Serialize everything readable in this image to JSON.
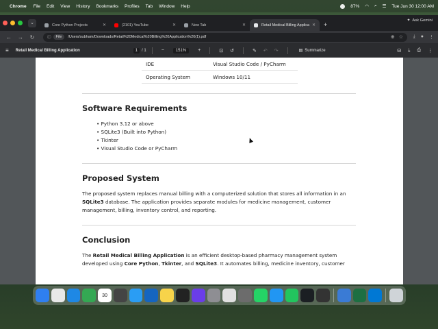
{
  "menubar": {
    "app_name": "Chrome",
    "items": [
      "File",
      "Edit",
      "View",
      "History",
      "Bookmarks",
      "Profiles",
      "Tab",
      "Window",
      "Help"
    ],
    "battery": "87%",
    "datetime": "Tue Jun 30  12:00 AM"
  },
  "tabs": [
    {
      "title": "Core Python Projects",
      "color": "#9aa0a6"
    },
    {
      "title": "(2101) YouTube",
      "color": "#ff0000"
    },
    {
      "title": "New Tab",
      "color": "#9aa0a6"
    },
    {
      "title": "Retail Medical Billing Applica",
      "color": "#e8eaed"
    }
  ],
  "ask_label": "Ask Gemini",
  "omnibox": {
    "chip": "File",
    "url": "/Users/subham/Downloads/Retail%20Medical%20Billing%20Application%20(1).pdf"
  },
  "pdf_toolbar": {
    "title": "Retail Medical Billing Application",
    "page_current": "1",
    "page_total": "/  1",
    "zoom": "151%",
    "summarize": "Summarize"
  },
  "document": {
    "spec_rows": [
      {
        "key": "IDE",
        "value": "Visual Studio Code / PyCharm"
      },
      {
        "key": "Operating System",
        "value": "Windows 10/11"
      }
    ],
    "software_heading": "Software Requirements",
    "software_items": [
      "Python 3.12 or above",
      "SQLite3 (Built into Python)",
      "Tkinter",
      "Visual Studio Code or PyCharm"
    ],
    "proposed_heading": "Proposed System",
    "proposed_pre": "The proposed system replaces manual billing with a computerized solution that stores all information in an ",
    "proposed_bold": "SQLite3",
    "proposed_post": " database. The application provides separate modules for medicine management, customer management, billing, inventory control, and reporting.",
    "conclusion_heading": "Conclusion",
    "conclusion_pre": "The ",
    "conclusion_bold1": "Retail Medical Billing Application",
    "conclusion_mid1": " is an efficient desktop-based pharmacy management system developed using ",
    "conclusion_bold2": "Core Python",
    "conclusion_comma": ", ",
    "conclusion_bold3": "Tkinter",
    "conclusion_and": ", and ",
    "conclusion_bold4": "SQLite3",
    "conclusion_post": ". It automates billing, medicine inventory, customer"
  },
  "dock": {
    "apps": [
      {
        "name": "finder",
        "color": "#2f7ff0"
      },
      {
        "name": "launchpad",
        "color": "#e8e8e8"
      },
      {
        "name": "safari",
        "color": "#1e88e5"
      },
      {
        "name": "chrome",
        "color": "#34a853"
      },
      {
        "name": "calendar",
        "color": "#ffffff",
        "label": "30"
      },
      {
        "name": "camera",
        "color": "#444444"
      },
      {
        "name": "quicktime",
        "color": "#2a9df4"
      },
      {
        "name": "finder-alt",
        "color": "#1565c0"
      },
      {
        "name": "notes",
        "color": "#f7d34a"
      },
      {
        "name": "terminal",
        "color": "#222222"
      },
      {
        "name": "imovie",
        "color": "#6a3de8"
      },
      {
        "name": "settings",
        "color": "#8e8e93"
      },
      {
        "name": "script-editor",
        "color": "#e0e0e0"
      },
      {
        "name": "sqlite",
        "color": "#6c6c6c"
      },
      {
        "name": "whatsapp",
        "color": "#25d366"
      },
      {
        "name": "vscode",
        "color": "#2196f3"
      },
      {
        "name": "pycharm",
        "color": "#22c55e"
      },
      {
        "name": "github",
        "color": "#1b1f23"
      },
      {
        "name": "cube",
        "color": "#333333"
      },
      {
        "name": "preview",
        "color": "#3a7bd5"
      },
      {
        "name": "excel",
        "color": "#1d6f42"
      },
      {
        "name": "vscode-alt",
        "color": "#0078d4"
      },
      {
        "name": "trash",
        "color": "#cfd4d8"
      }
    ]
  }
}
